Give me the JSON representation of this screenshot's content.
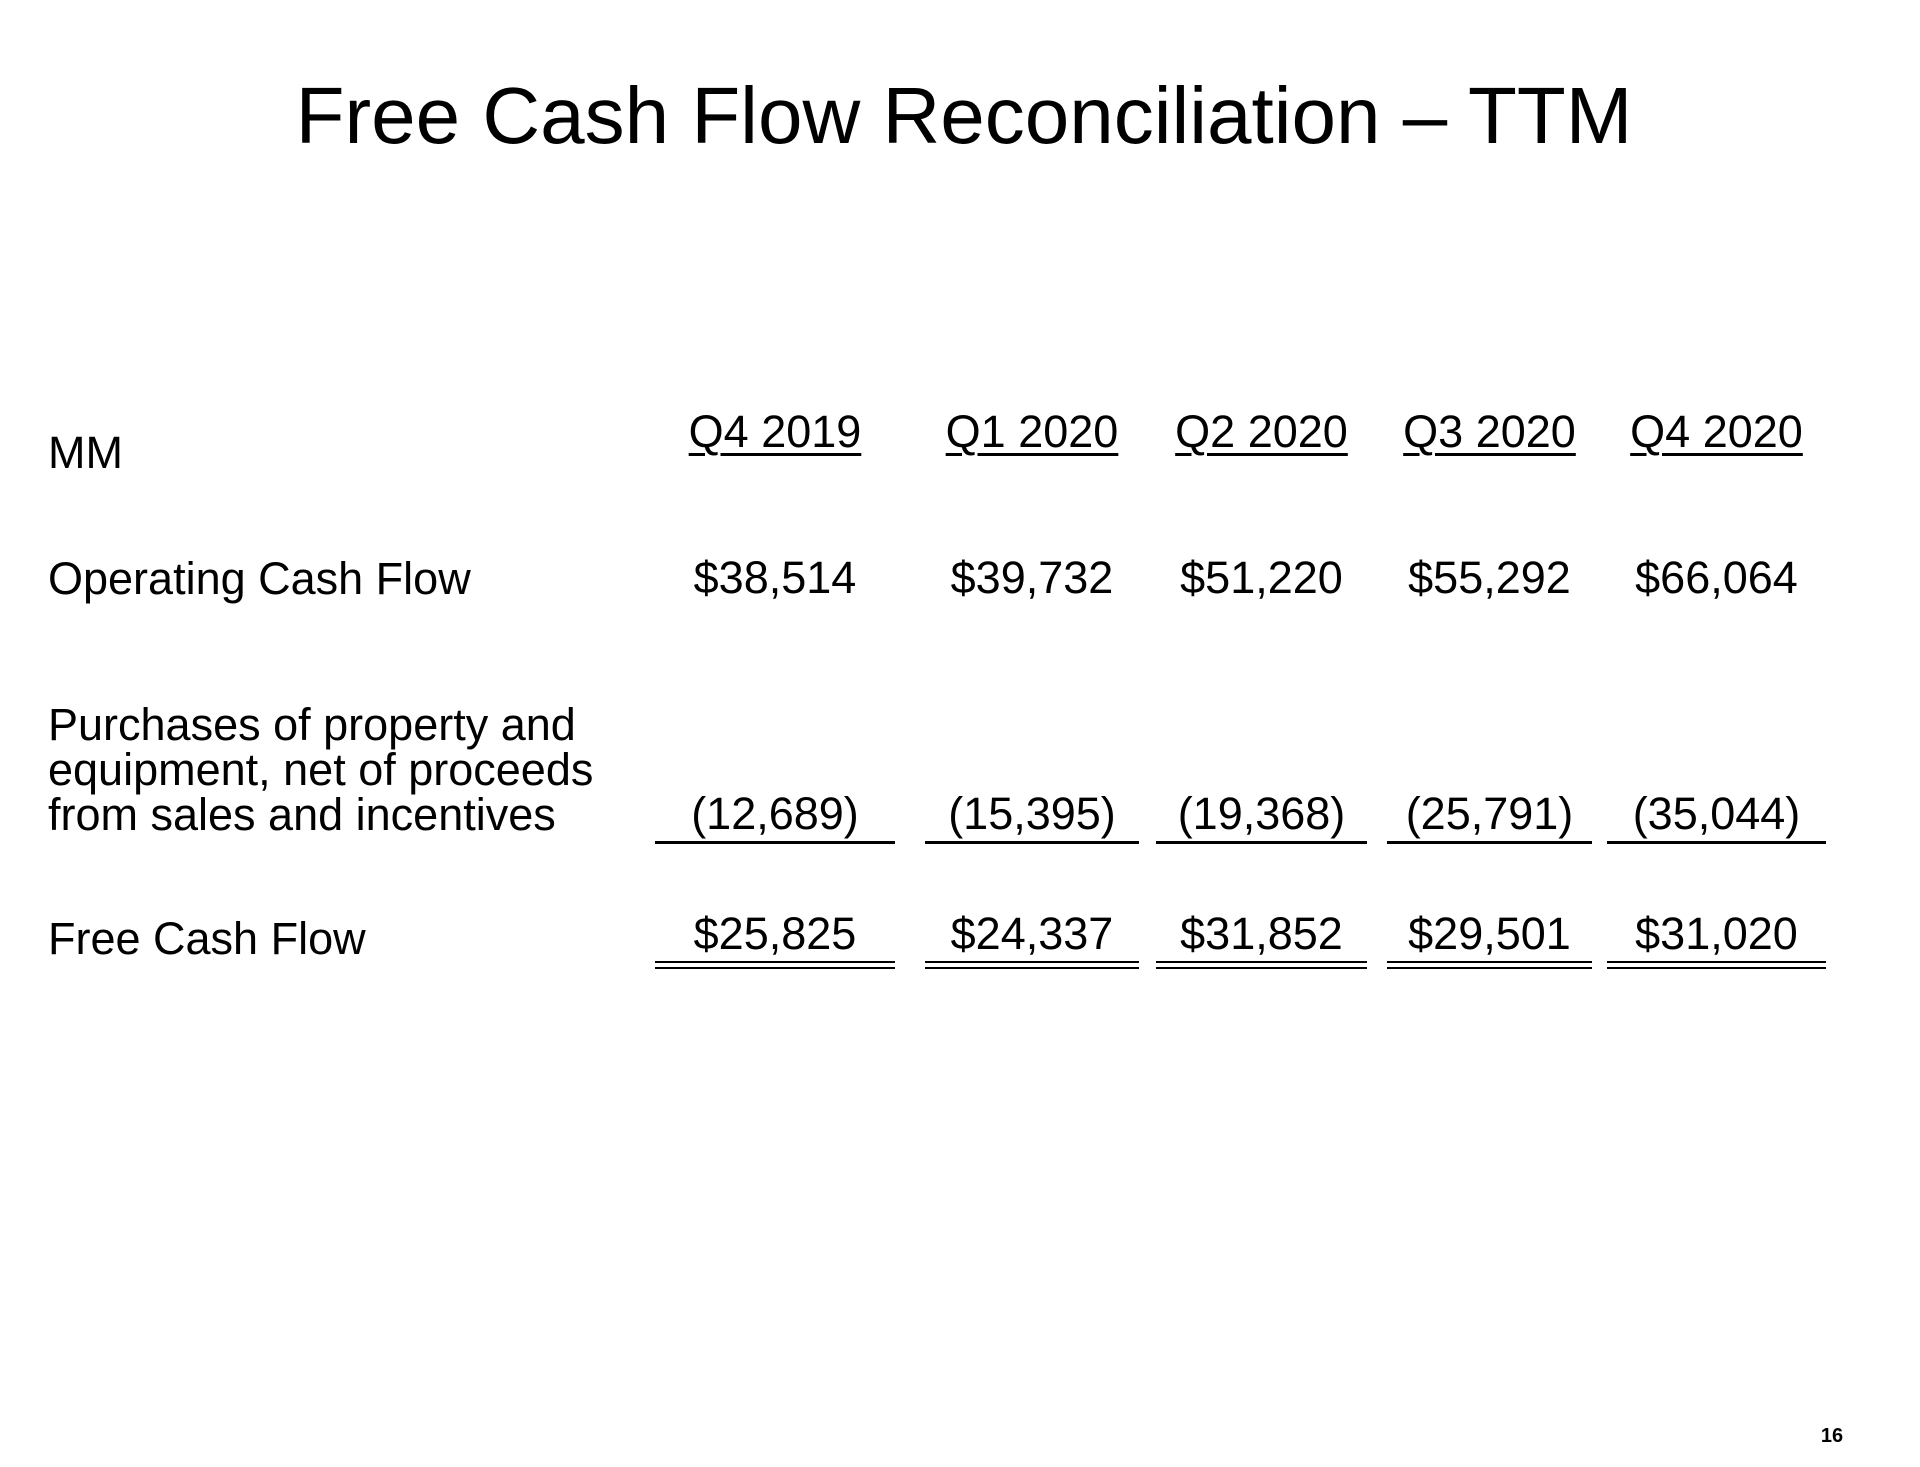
{
  "slide": {
    "title": "Free Cash Flow Reconciliation – TTM",
    "page_number": "16"
  },
  "table": {
    "units_label": "MM",
    "columns": [
      "Q4 2019",
      "Q1 2020",
      "Q2 2020",
      "Q3 2020",
      "Q4 2020"
    ],
    "rows": [
      {
        "label_lines": [
          "Operating Cash Flow"
        ],
        "values": [
          "$38,514",
          "$39,732",
          "$51,220",
          "$55,292",
          "$66,064"
        ],
        "rule": "none"
      },
      {
        "label_lines": [
          "Purchases of property and",
          "equipment, net of proceeds",
          "from sales and incentives"
        ],
        "values": [
          "(12,689)",
          "(15,395)",
          "(19,368)",
          "(25,791)",
          "(35,044)"
        ],
        "rule": "single"
      },
      {
        "label_lines": [
          "Free Cash Flow"
        ],
        "values": [
          "$25,825",
          "$24,337",
          "$31,852",
          "$29,501",
          "$31,020"
        ],
        "rule": "double"
      }
    ]
  }
}
